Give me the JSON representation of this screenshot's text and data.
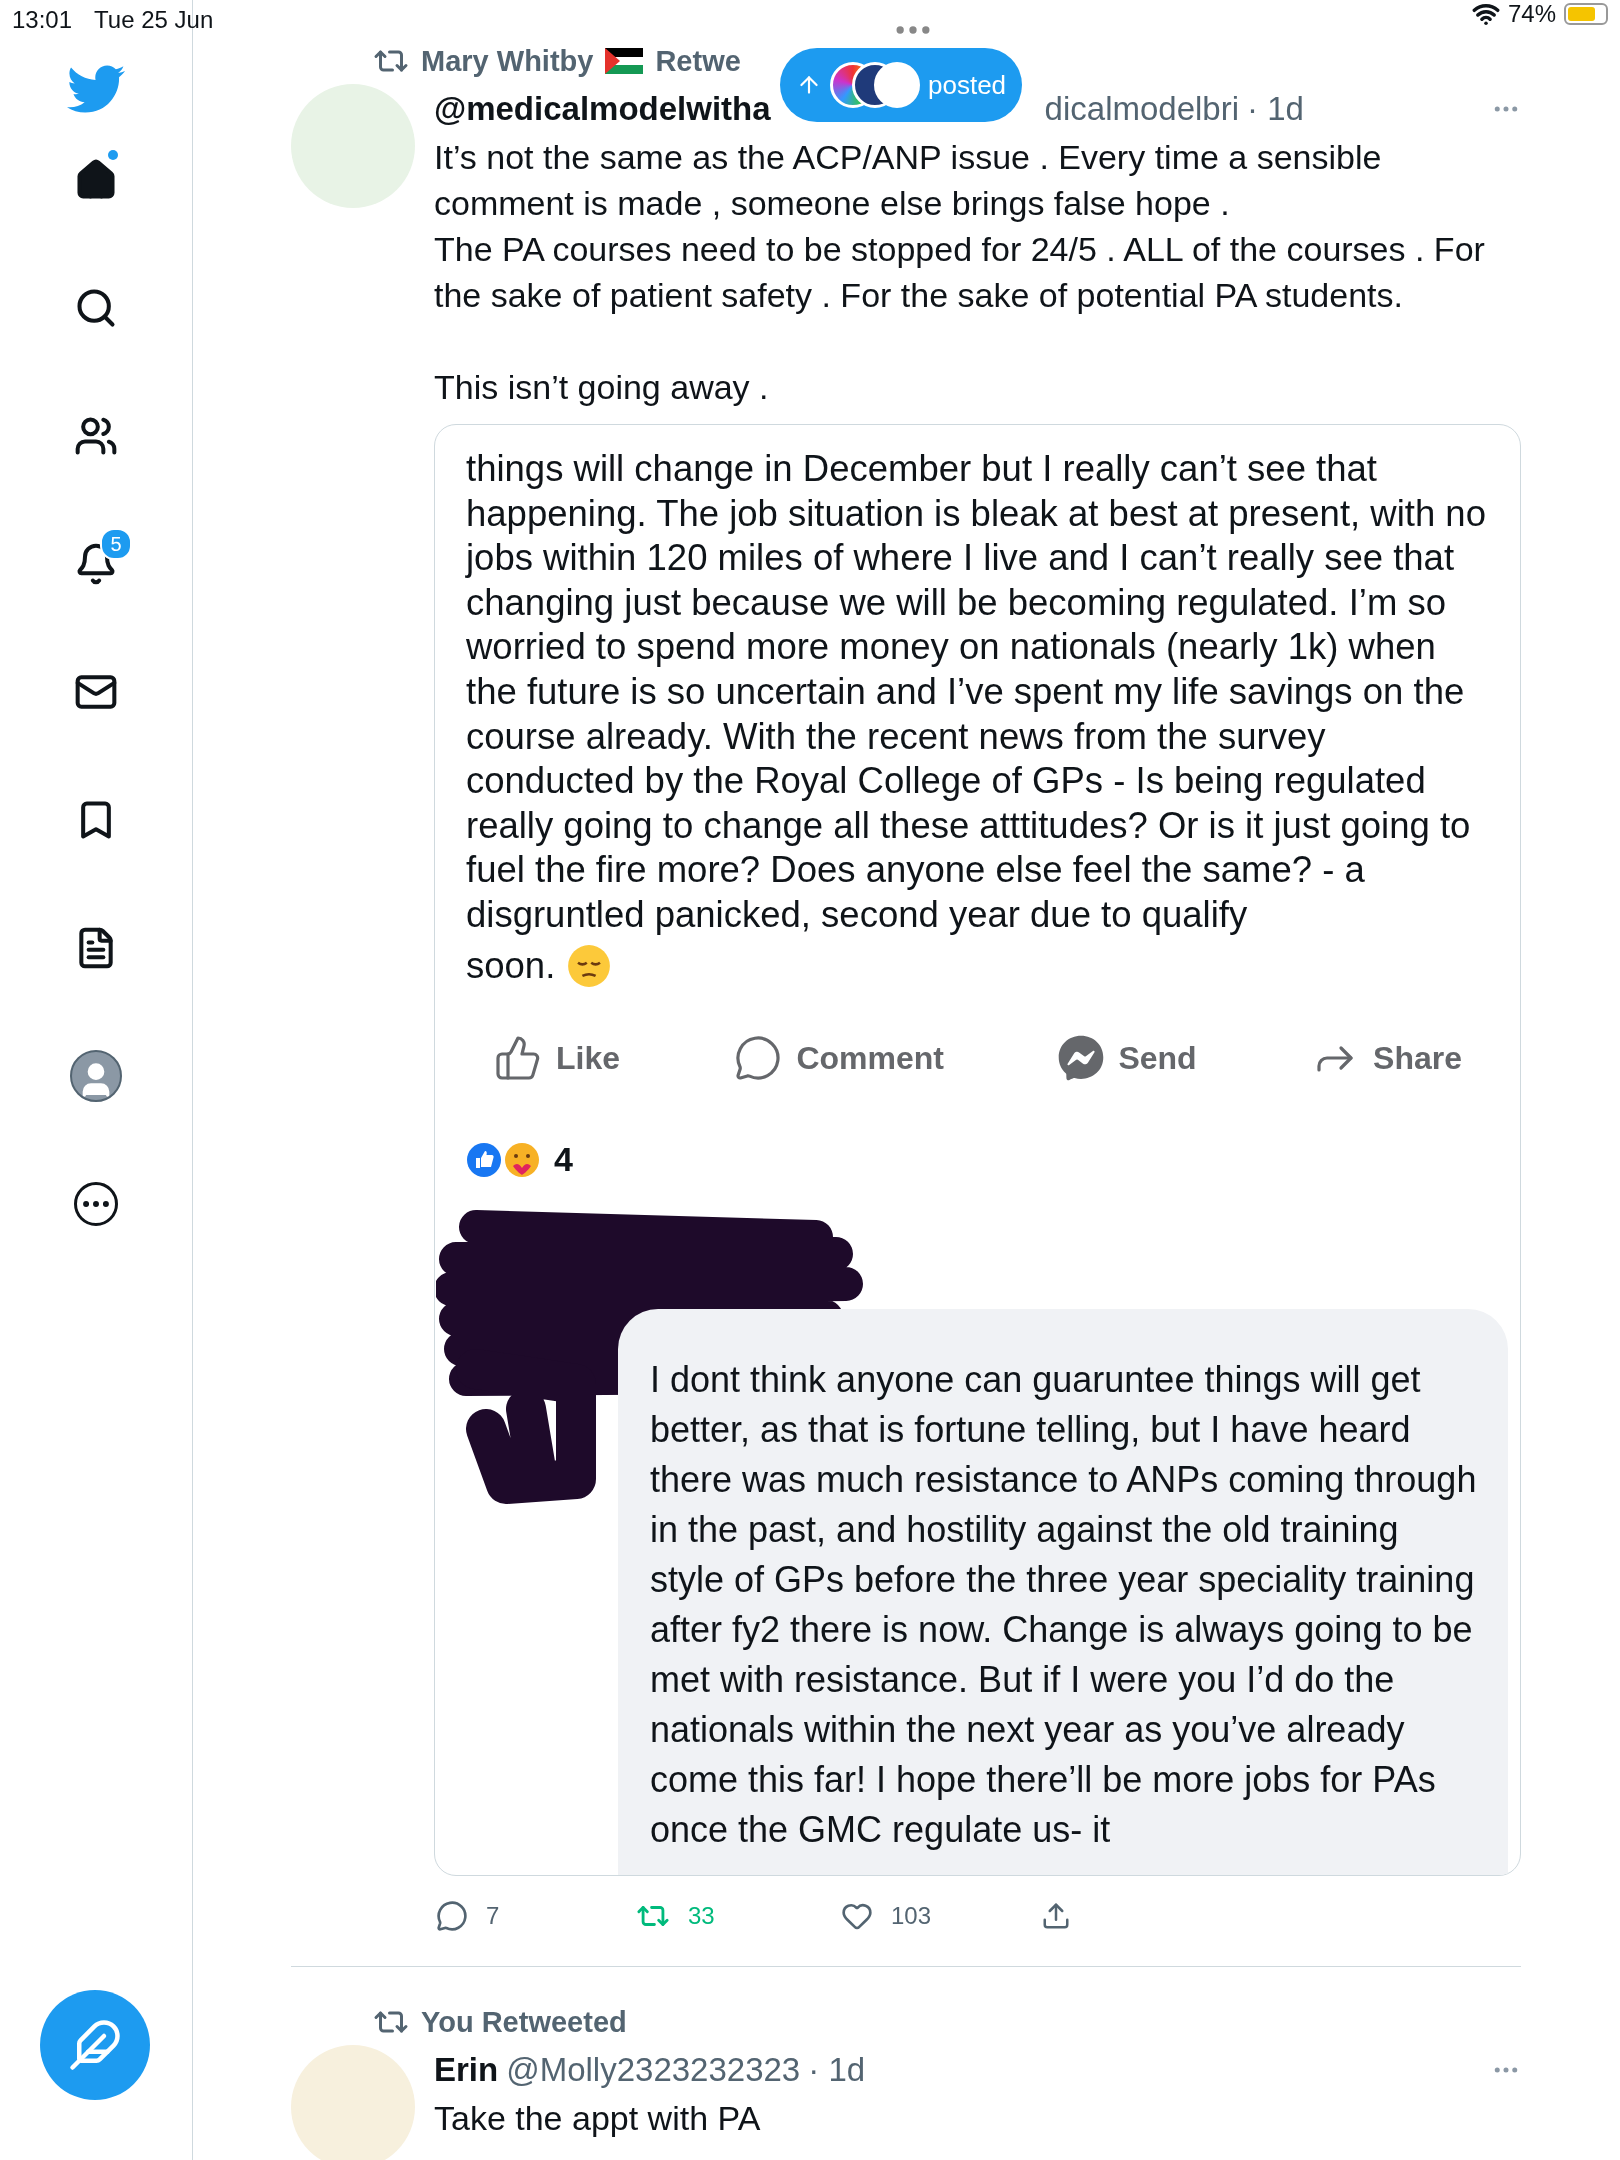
{
  "status_bar": {
    "time": "13:01",
    "date": "Tue 25 Jun",
    "battery": "74%"
  },
  "sidebar": {
    "items": [
      {
        "kind": "home",
        "unread": true
      },
      {
        "kind": "search"
      },
      {
        "kind": "communities"
      },
      {
        "kind": "notifications",
        "badge": "5"
      },
      {
        "kind": "messages"
      },
      {
        "kind": "bookmarks"
      },
      {
        "kind": "lists"
      },
      {
        "kind": "profile"
      },
      {
        "kind": "more"
      }
    ]
  },
  "new_posts_pill": {
    "label": "posted"
  },
  "tweets": [
    {
      "context_name": "Mary Whitby",
      "context_flag": true,
      "context_text": "Retwe",
      "name": "@medicalmodelwitha",
      "handle": "dicalmodelbri",
      "time": "· 1d",
      "text": "It’s not the same as the ACP/ANP issue . Every time a sensible comment is made , someone else brings false hope .\nThe PA courses need to be stopped for 24/5 . ALL of the courses . For the sake of patient safety . For the sake of potential PA students.\n\nThis isn’t going away .",
      "attachment": {
        "post_text": "things will change in December but I really can’t see that happening. The job situation is bleak at best at present, with no jobs within 120 miles of where I live and I can’t really see that changing just because we will be becoming regulated. I’m so worried to spend more money on nationals (nearly 1k) when the future is so uncertain and I’ve spent my life savings on the course already. With the recent news from the survey conducted by the Royal College of GPs - Is being regulated really going to change all these atttitudes? Or is it just going to fuel the fire more? Does anyone else feel the same? - a disgruntled panicked, second year due to qualify",
        "post_text_end": "soon.",
        "actions": [
          {
            "kind": "like",
            "label": "Like"
          },
          {
            "kind": "comment",
            "label": "Comment"
          },
          {
            "kind": "send",
            "label": "Send"
          },
          {
            "kind": "share",
            "label": "Share"
          }
        ],
        "reaction_count": "4",
        "comment": "I dont think anyone can guaruntee things will get better, as that is fortune telling, but I have heard there was much resistance to ANPs coming through in the past, and hostility against the old training style of GPs before the three year speciality training after fy2 there is now. Change is always going to be met with resistance. But if I were you I’d do the nationals within the next year as you’ve already come this far! I hope there’ll be more jobs for PAs once the GMC regulate us- it"
      },
      "stats": {
        "replies": "7",
        "retweets": "33",
        "likes": "103",
        "retweeted": true,
        "liked": false
      }
    },
    {
      "context_name": "You Retweeted",
      "context_flag": false,
      "name": "Erin",
      "handle": "@Molly2323232323",
      "time": "· 1d",
      "text": "Take the appt with PA"
    }
  ]
}
